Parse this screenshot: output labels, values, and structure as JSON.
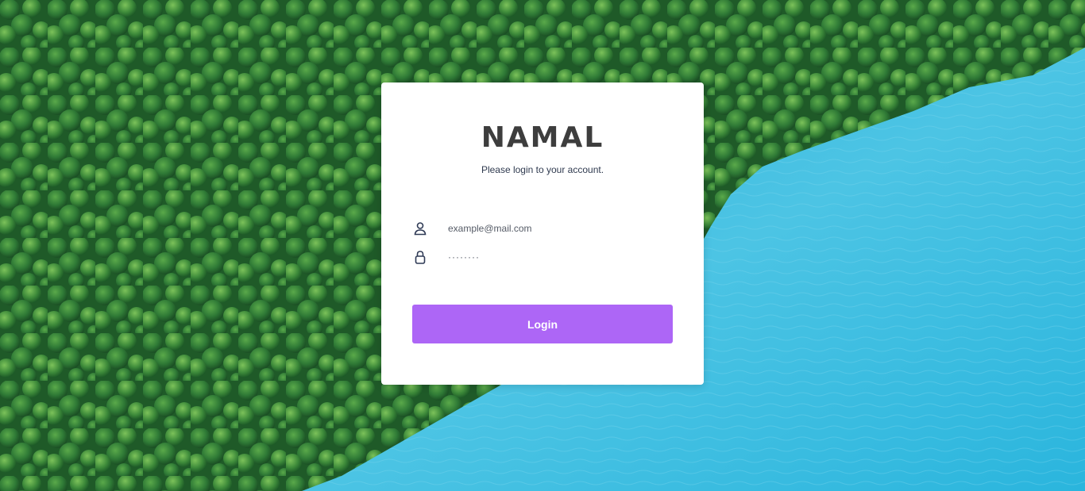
{
  "brand": {
    "name": "NAMAL",
    "subtitle": "Please login to your account."
  },
  "form": {
    "email": {
      "value": "",
      "placeholder": "example@mail.com",
      "icon": "user-icon"
    },
    "password": {
      "value": "········",
      "icon": "lock-icon"
    },
    "login_label": "Login"
  },
  "colors": {
    "button": "#ad66f6",
    "brand_text": "#3d3d3d",
    "water": "#3cbfe0",
    "forest": "#2a6b33"
  }
}
